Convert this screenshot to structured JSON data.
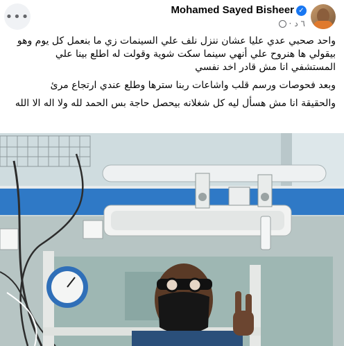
{
  "post": {
    "author": "Mohamed Sayed Bisheer",
    "time": "٦ د",
    "separator": "·",
    "paragraphs": [
      "واحد صحبي عدي عليا عشان ننزل نلف علي السينمات زي ما بنعمل كل يوم وهو بيقولي ها هنروح علي أنهي سينما سكت شوية وقولت له اطلع بينا علي المستشفي انا مش قادر اخد نفسي",
      "وبعد فحوصات ورسم قلب واشاعات ربنا سترها وطلع عندي ارتجاع مرئ",
      "والحقيقة انا مش هسأل ليه كل شغلانه بيحصل حاجة بس الحمد لله ولا اله الا الله"
    ]
  },
  "icons": {
    "more": "more-options-icon",
    "verified": "verified-badge-icon",
    "audience": "globe-icon"
  },
  "colors": {
    "name": "#050505",
    "meta": "#65676b",
    "verified": "#1877f2",
    "wall_blue": "#2f79c6"
  }
}
